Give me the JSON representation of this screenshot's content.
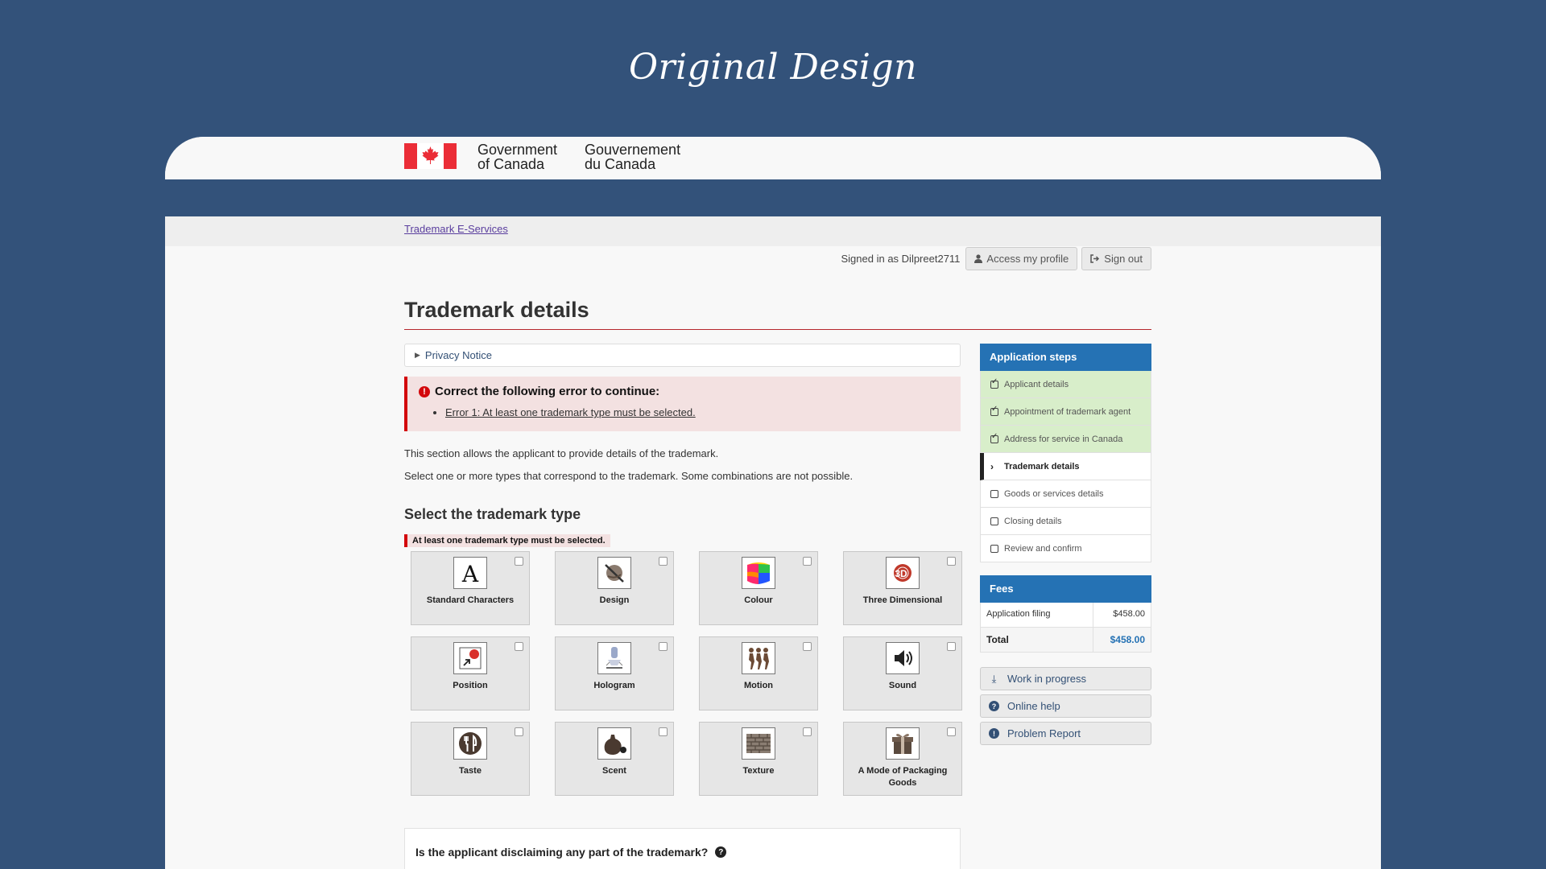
{
  "showcase": {
    "title": "Original Design"
  },
  "gov": {
    "en_line1": "Government",
    "en_line2": "of Canada",
    "fr_line1": "Gouvernement",
    "fr_line2": "du Canada"
  },
  "breadcrumb": {
    "link": "Trademark E-Services"
  },
  "user": {
    "signed_in": "Signed in as Dilpreet2711",
    "profile_btn": "Access my profile",
    "signout_btn": "Sign out"
  },
  "page": {
    "title": "Trademark details"
  },
  "privacy": {
    "label": "Privacy Notice"
  },
  "error": {
    "title": "Correct the following error to continue:",
    "items": [
      "Error 1: At least one trademark type must be selected."
    ]
  },
  "description": {
    "line1": "This section allows the applicant to provide details of the trademark.",
    "line2": "Select one or more types that correspond to the trademark. Some combinations are not possible."
  },
  "type_section": {
    "heading": "Select the trademark type",
    "error": "At least one trademark type must be selected.",
    "types": [
      {
        "label": "Standard Characters",
        "icon": "letter-a-icon"
      },
      {
        "label": "Design",
        "icon": "design-icon"
      },
      {
        "label": "Colour",
        "icon": "colour-icon"
      },
      {
        "label": "Three Dimensional",
        "icon": "three-dimensional-icon"
      },
      {
        "label": "Position",
        "icon": "position-icon"
      },
      {
        "label": "Hologram",
        "icon": "hologram-icon"
      },
      {
        "label": "Motion",
        "icon": "motion-icon"
      },
      {
        "label": "Sound",
        "icon": "sound-icon"
      },
      {
        "label": "Taste",
        "icon": "taste-icon"
      },
      {
        "label": "Scent",
        "icon": "scent-icon"
      },
      {
        "label": "Texture",
        "icon": "texture-icon"
      },
      {
        "label": "A Mode of Packaging Goods",
        "icon": "packaging-icon"
      }
    ]
  },
  "disclaimer": {
    "question": "Is the applicant disclaiming any part of the trademark?"
  },
  "steps": {
    "heading": "Application steps",
    "items": [
      {
        "label": "Applicant details",
        "state": "done"
      },
      {
        "label": "Appointment of trademark agent",
        "state": "done"
      },
      {
        "label": "Address for service in Canada",
        "state": "done"
      },
      {
        "label": "Trademark details",
        "state": "current"
      },
      {
        "label": "Goods or services details",
        "state": "todo"
      },
      {
        "label": "Closing details",
        "state": "todo"
      },
      {
        "label": "Review and confirm",
        "state": "todo"
      }
    ]
  },
  "fees": {
    "heading": "Fees",
    "application_filing_label": "Application filing",
    "application_filing_value": "$458.00",
    "total_label": "Total",
    "total_value": "$458.00"
  },
  "side_buttons": {
    "wip": "Work in progress",
    "help": "Online help",
    "problem": "Problem Report"
  },
  "colors": {
    "background": "#33527a",
    "accent_blue": "#2572b4",
    "error_red": "#d3080c",
    "done_green": "#d8eeca"
  }
}
